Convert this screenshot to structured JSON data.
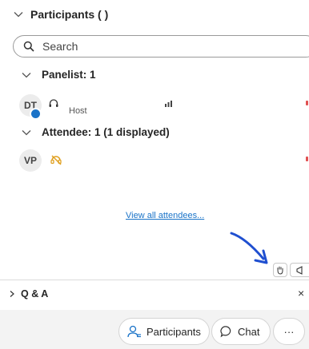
{
  "participants": {
    "header_title": "Participants ( )",
    "search_placeholder": "Search"
  },
  "panelist": {
    "section_label": "Panelist: 1",
    "initials": "DT",
    "role": "Host"
  },
  "attendee": {
    "section_label": "Attendee: 1 (1 displayed)",
    "initials": "VP",
    "view_all_link": "View all attendees..."
  },
  "qa_panel": {
    "title": "Q & A",
    "close_symbol": "×"
  },
  "footer": {
    "participants_label": "Participants",
    "chat_label": "Chat",
    "more_symbol": "···"
  },
  "colors": {
    "accent_blue": "#1a73c8",
    "annotation_arrow": "#1f4fd0",
    "mute_orange": "#e0a020",
    "status_red": "#e05050"
  },
  "icons": {
    "collapse": "chevron-down-icon",
    "expand": "chevron-right-icon",
    "search": "search-icon",
    "headset": "headset-icon",
    "signal": "signal-bars-icon",
    "mic_muted": "mic-muted-icon",
    "raise_hand": "raise-hand-icon",
    "megaphone": "megaphone-icon",
    "participants": "participants-icon",
    "chat": "chat-bubble-icon",
    "more": "more-icon",
    "close": "close-icon"
  }
}
